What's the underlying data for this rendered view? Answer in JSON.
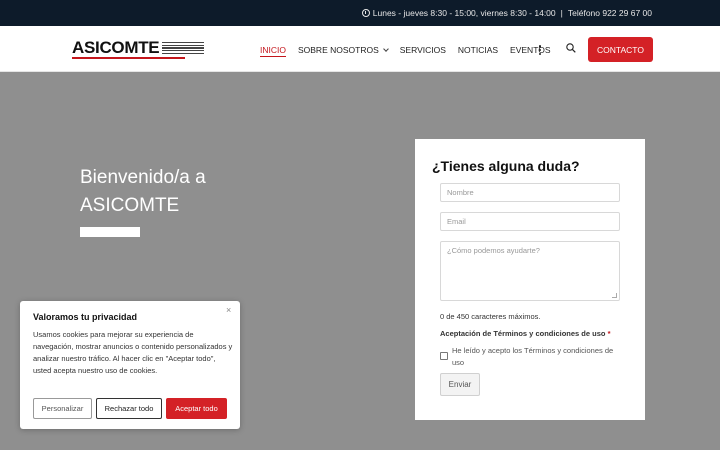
{
  "topbar": {
    "schedule": "Lunes - jueves 8:30 - 15:00, viernes 8:30 - 14:00",
    "separator": "|",
    "phone": "Teléfono 922 29 67 00"
  },
  "header": {
    "logo_text": "ASICOMTE",
    "nav": {
      "inicio": "INICIO",
      "sobre": "SOBRE NOSOTROS",
      "servicios": "SERVICIOS",
      "noticias": "NOTICIAS",
      "eventos": "EVENTOS"
    },
    "contact_label": "CONTACTO"
  },
  "hero": {
    "title": "Bienvenido/a a ASICOMTE"
  },
  "form": {
    "title": "¿Tienes alguna duda?",
    "name_placeholder": "Nombre",
    "email_placeholder": "Email",
    "message_placeholder": "¿Cómo podemos ayudarte?",
    "char_count": "0 de 450 caracteres máximos.",
    "terms_label": "Aceptación de Términos y condiciones de uso",
    "required_mark": "*",
    "terms_check": "He leído y acepto los Términos y condiciones de uso",
    "submit_label": "Enviar"
  },
  "cookie": {
    "title": "Valoramos tu privacidad",
    "close": "×",
    "body": "Usamos cookies para mejorar su experiencia de navegación, mostrar anuncios o contenido personalizados y analizar nuestro tráfico. Al hacer clic en \"Aceptar todo\", usted acepta nuestro uso de cookies.",
    "customize_label": "Personalizar",
    "reject_label": "Rechazar todo",
    "accept_label": "Aceptar todo"
  },
  "colors": {
    "accent": "#d42126",
    "topbar_bg": "#0d1b2a",
    "hero_bg": "#8f8f8f"
  }
}
